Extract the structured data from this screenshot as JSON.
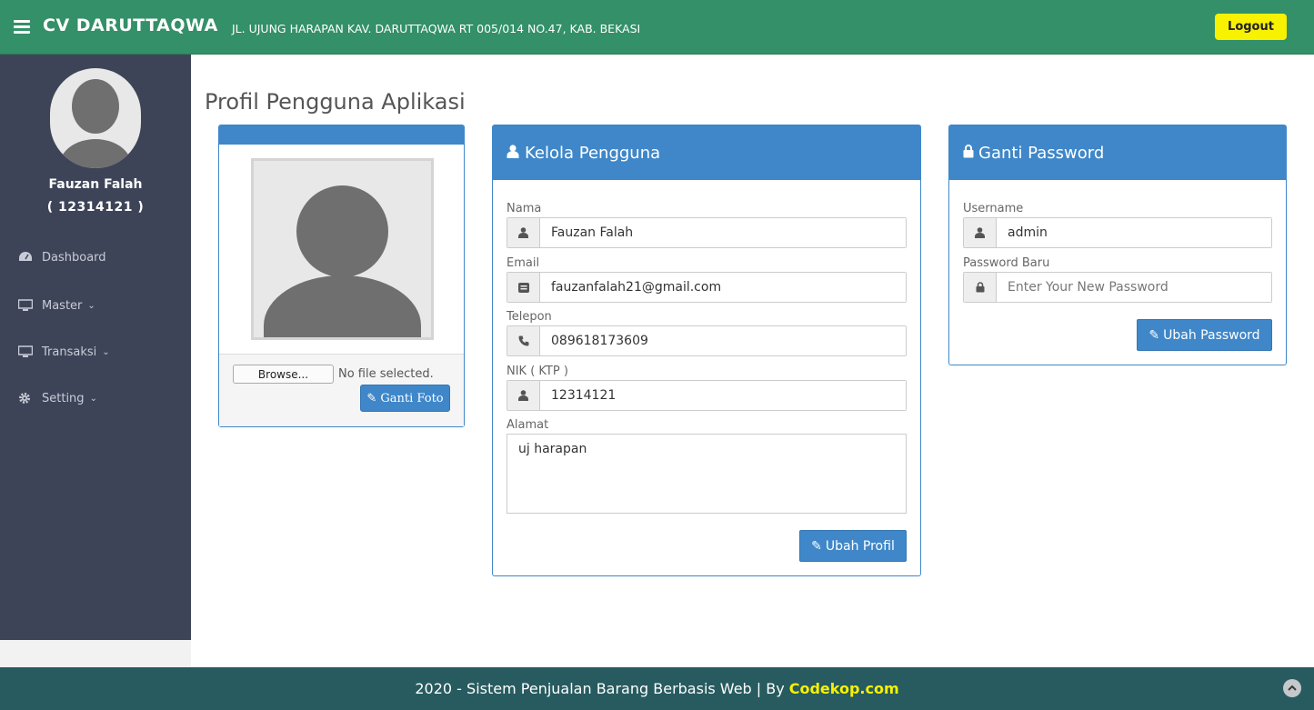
{
  "header": {
    "brand": "CV DARUTTAQWA",
    "address": "JL. UJUNG HARAPAN KAV. DARUTTAQWA RT 005/014 NO.47, KAB. BEKASI",
    "logout_label": "Logout",
    "logout_color": "#f8f100",
    "bar_color": "#339068"
  },
  "sidebar": {
    "user_name": "Fauzan Falah",
    "user_id": "( 12314121 )",
    "items": [
      {
        "label": "Dashboard",
        "icon": "dashboard-icon"
      },
      {
        "label": "Master",
        "icon": "monitor-icon"
      },
      {
        "label": "Transaksi",
        "icon": "monitor-icon"
      },
      {
        "label": "Setting",
        "icon": "gear-icon"
      }
    ]
  },
  "page": {
    "title": "Profil Pengguna Aplikasi"
  },
  "photo_panel": {
    "browse_label": "Browse...",
    "file_status": "No file selected.",
    "change_photo_label": "Ganti Foto"
  },
  "profile_panel": {
    "title": "Kelola Pengguna",
    "fields": {
      "name": {
        "label": "Nama",
        "value": "Fauzan Falah"
      },
      "email": {
        "label": "Email",
        "value": "fauzanfalah21@gmail.com"
      },
      "phone": {
        "label": "Telepon",
        "value": "089618173609"
      },
      "nik": {
        "label": "NIK ( KTP )",
        "value": "12314121"
      },
      "address": {
        "label": "Alamat",
        "value": "uj harapan"
      }
    },
    "submit_label": "Ubah Profil"
  },
  "password_panel": {
    "title": "Ganti Password",
    "username_label": "Username",
    "username_value": "admin",
    "new_password_label": "Password Baru",
    "new_password_placeholder": "Enter Your New Password",
    "submit_label": "Ubah Password"
  },
  "footer": {
    "text": "2020 - Sistem Penjualan Barang Berbasis Web | By",
    "brand": "Codekop.com"
  },
  "colors": {
    "accent": "#3f87c9",
    "sidebar": "#3e4458",
    "footer": "#275b5f"
  }
}
